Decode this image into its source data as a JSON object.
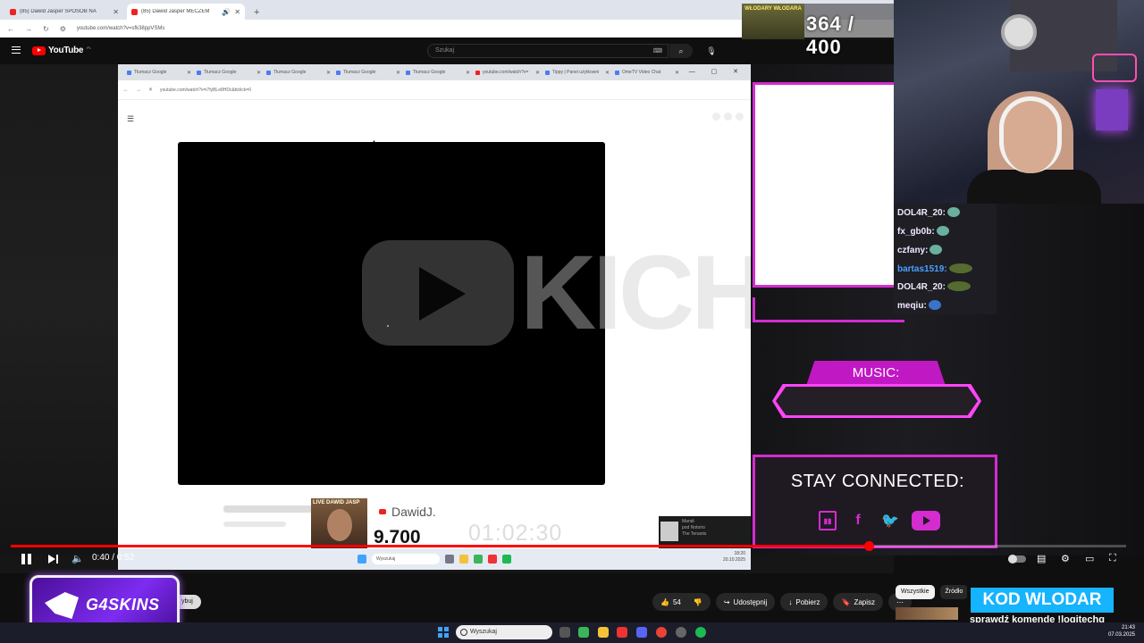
{
  "browser": {
    "tabs": [
      {
        "title": "(85) Dawid Jasper SPOSÓB NA"
      },
      {
        "title": "(85) Dawid Jasper MECZEM"
      }
    ],
    "url": "youtube.com/watch?v=sfk38ppVSMs"
  },
  "youtube": {
    "logo": "YouTube",
    "region": "PL",
    "search_placeholder": "Szukaj"
  },
  "inner_screen": {
    "tabs": [
      "Tłumacz Google",
      "Tłumacz Google",
      "Tłumacz Google",
      "Tłumacz Google",
      "Tłumacz Google",
      "youtube.com/watch?v=",
      "Tippy | Panel użytkowni",
      "OmeTV Video Chat"
    ],
    "url": "youtube.com/watch?v=i7fyBLe8HDc&ttclick=0",
    "watermark_text": "KICHAL",
    "live_badge": "LIVE DAWID JASP",
    "channel": "DawidJ.",
    "count": "9.700",
    "timer": "01:02:30",
    "popup": {
      "title": "Mandi",
      "line2": "pod Notorio",
      "line3": "The Tenants"
    },
    "taskbar_search": "Wyszukaj",
    "clock": {
      "time": "18:20",
      "date": "20.10.2025"
    }
  },
  "stream_overlay": {
    "viewers_thumb": "WŁODARY WŁODARA",
    "viewer_count": "364 / 400",
    "chat": [
      {
        "user": "DOL4R_20:"
      },
      {
        "user": "fx_gb0b:"
      },
      {
        "user": "czfany:"
      },
      {
        "user": "bartas1519:"
      },
      {
        "user": "DOL4R_20:"
      },
      {
        "user": "meqiu:"
      }
    ],
    "music_label": "MUSIC:",
    "stay_connected": "STAY CONNECTED:",
    "sponsor_logo": "G4SKINS",
    "promo_title": "KOD WLODAR",
    "promo_sub": "sprawdź komendę !logitechg"
  },
  "player": {
    "time": "0:40 / 0:52",
    "progress": 0.77
  },
  "actions": {
    "subscribe_tail": "ybuj",
    "likes": "54",
    "share": "Udostępnij",
    "download": "Pobierz",
    "save": "Zapisz",
    "more": "⋯"
  },
  "filter_chips": [
    "Wszystkie",
    "Źródło"
  ],
  "windows_taskbar": {
    "search": "Wyszukaj",
    "time": "21:43",
    "date": "07.03.2025"
  }
}
